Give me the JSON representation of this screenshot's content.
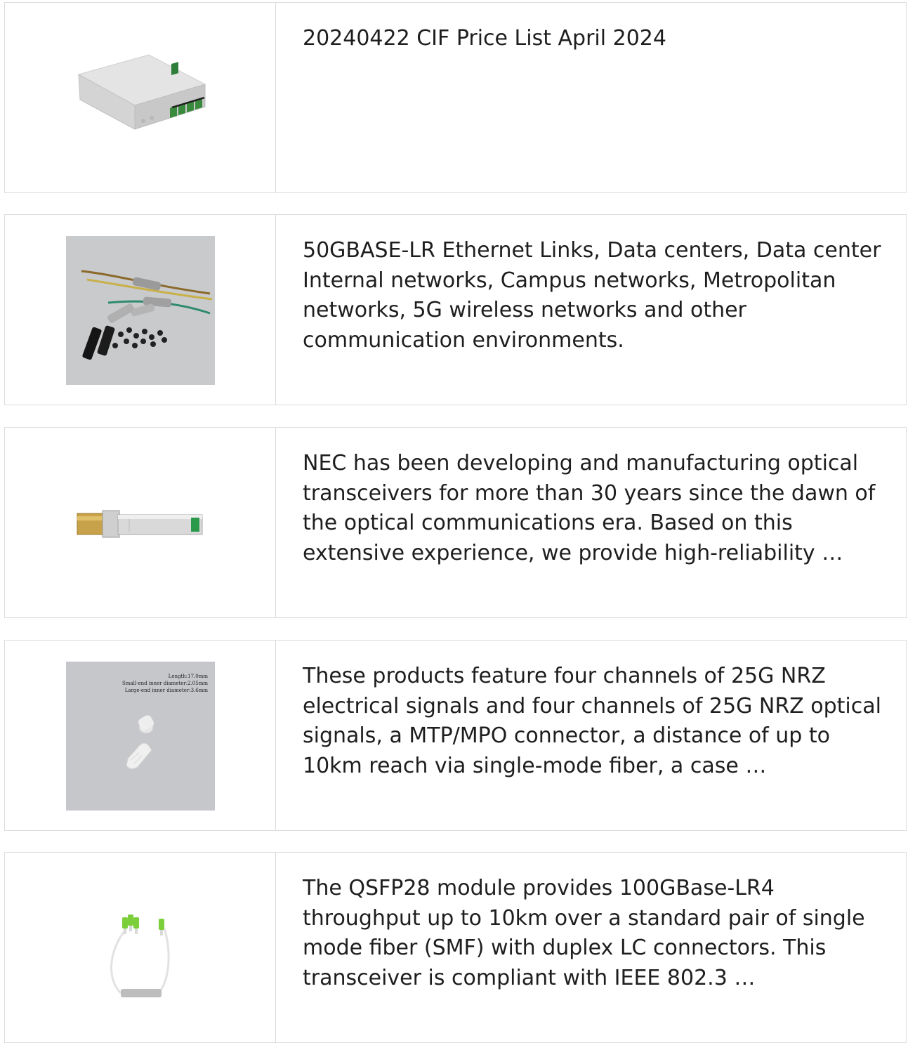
{
  "items": [
    {
      "description": "20240422 CIF Price List April 2024",
      "image_icon": "fiber-termination-box-icon"
    },
    {
      "description": "50GBASE-LR Ethernet Links, Data centers, Data center Internal networks, Campus networks, Metropolitan networks, 5G wireless networks and other communication environments.",
      "image_icon": "cable-accessories-icon"
    },
    {
      "description": "NEC has been developing and manufacturing optical transceivers for more than 30 years since the dawn of the optical communications era. Based on this extensive experience, we provide high-reliability …",
      "image_icon": "sfp-transceiver-icon"
    },
    {
      "description": "These products feature four channels of 25G NRZ electrical signals and four channels of 25G NRZ optical signals, a MTP/MPO connector, a distance of up to 10km reach via single-mode fiber, a case …",
      "image_icon": "boot-sleeve-icon",
      "image_caption": [
        "Length:17.0mm",
        "Small-end inner diameter:2.05mm",
        "Large-end inner diameter:3.6mm"
      ]
    },
    {
      "description": "The QSFP28 module provides 100GBase-LR4 throughput up to 10km over a standard pair of single mode fiber (SMF) with duplex LC connectors. This transceiver is compliant with IEEE 802.3 …",
      "image_icon": "plc-splitter-icon"
    }
  ]
}
